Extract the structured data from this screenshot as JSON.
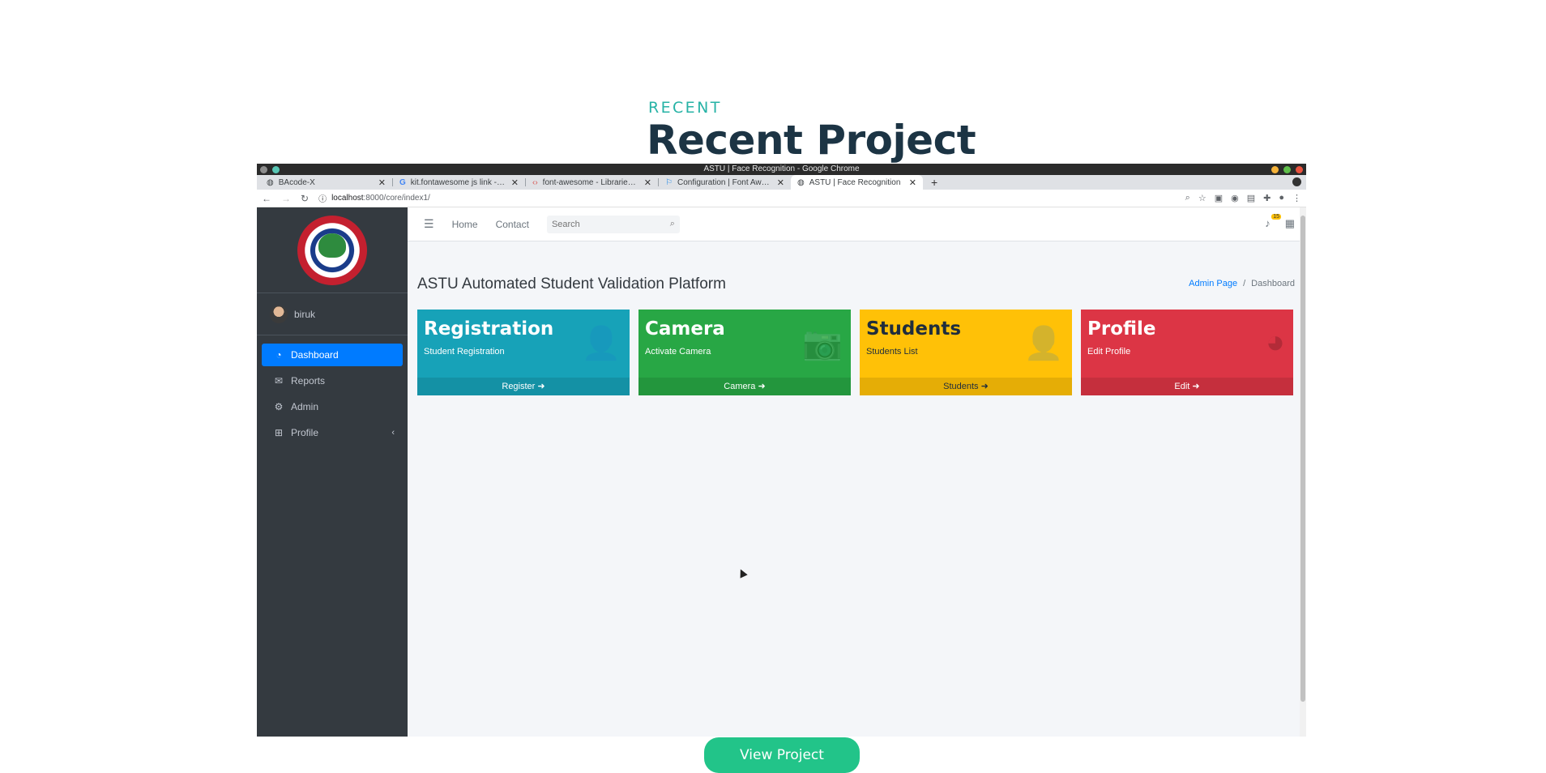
{
  "section": {
    "eyebrow": "RECENT",
    "title": "Recent Project"
  },
  "browser": {
    "window_title": "ASTU | Face Recognition - Google Chrome",
    "tabs": [
      {
        "label": "BAcode-X",
        "icon": "globe-icon",
        "active": false
      },
      {
        "label": "kit.fontawesome js link - Go",
        "icon": "google-icon",
        "active": false
      },
      {
        "label": "font-awesome - Libraries - c",
        "icon": "code-icon",
        "active": false
      },
      {
        "label": "Configuration | Font Aweso",
        "icon": "flag-icon",
        "active": false
      },
      {
        "label": "ASTU | Face Recognition",
        "icon": "globe-icon",
        "active": true
      }
    ],
    "url_host": "localhost",
    "url_path": ":8000/core/index1/"
  },
  "app": {
    "sidebar": {
      "user": "biruk",
      "items": [
        {
          "label": "Dashboard",
          "icon": "dashboard-icon",
          "active": true
        },
        {
          "label": "Reports",
          "icon": "envelope-icon",
          "active": false
        },
        {
          "label": "Admin",
          "icon": "user-gear-icon",
          "active": false
        },
        {
          "label": "Profile",
          "icon": "plus-square-icon",
          "active": false
        }
      ]
    },
    "topnav": {
      "home": "Home",
      "contact": "Contact",
      "search_placeholder": "Search",
      "notifications_count": "15"
    },
    "page_title": "ASTU Automated Student Validation Platform",
    "breadcrumb": {
      "link": "Admin Page",
      "current": "Dashboard"
    },
    "cards": [
      {
        "title": "Registration",
        "subtitle": "Student Registration",
        "footer": "Register",
        "icon": "user-plus-icon",
        "color": "#17a2b8"
      },
      {
        "title": "Camera",
        "subtitle": "Activate Camera",
        "footer": "Camera",
        "icon": "camera-icon",
        "color": "#28a745"
      },
      {
        "title": "Students",
        "subtitle": "Students List",
        "footer": "Students",
        "icon": "user-icon",
        "color": "#ffc107"
      },
      {
        "title": "Profile",
        "subtitle": "Edit Profile",
        "footer": "Edit",
        "icon": "pie-chart-icon",
        "color": "#dc3545"
      }
    ]
  },
  "cta": {
    "label": "View Project",
    "color": "#22c489"
  }
}
